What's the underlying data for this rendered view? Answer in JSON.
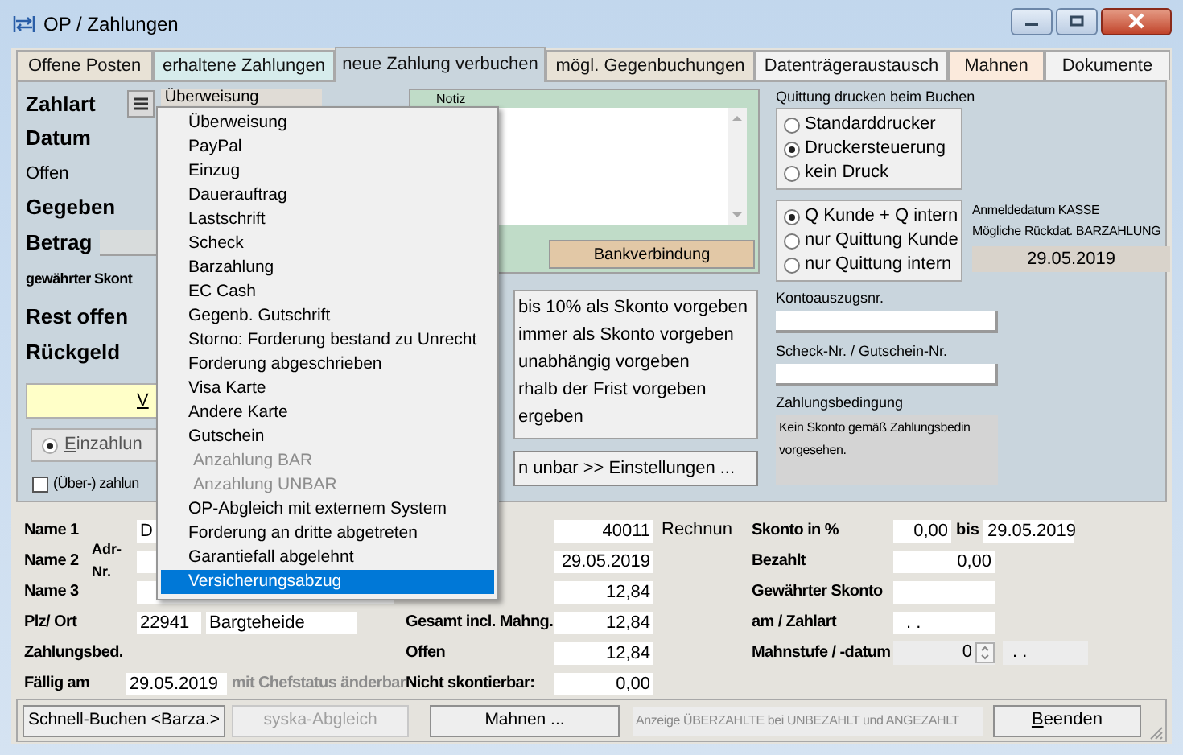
{
  "window": {
    "title": "OP / Zahlungen"
  },
  "tabs": [
    {
      "label": "Offene Posten",
      "selected": false,
      "color": "#e8e2d6"
    },
    {
      "label": "erhaltene Zahlungen",
      "selected": false,
      "color": "#d6ecec"
    },
    {
      "label": "neue Zahlung verbuchen",
      "selected": true,
      "color": "#c9d5dd"
    },
    {
      "label": "mögl. Gegenbuchungen",
      "selected": false,
      "color": "#e8e2d6"
    },
    {
      "label": "Datenträgeraustausch",
      "selected": false,
      "color": "#f2f2f2"
    },
    {
      "label": "Mahnen",
      "selected": false,
      "color": "#fbeadc"
    },
    {
      "label": "Dokumente",
      "selected": false,
      "color": "#f2f2f2"
    }
  ],
  "payment": {
    "zahlart": {
      "label": "Zahlart",
      "value": "Überweisung"
    },
    "labels": [
      {
        "text": "Datum",
        "kind": "heading"
      },
      {
        "text": "Offen",
        "kind": "plain"
      },
      {
        "text": "Gegeben",
        "kind": "heading"
      },
      {
        "text": "Betrag",
        "kind": "field"
      },
      {
        "text": "gewährter Skont",
        "kind": "small"
      },
      {
        "text": "Rest offen",
        "kind": "heading"
      },
      {
        "text": "Rückgeld",
        "kind": "heading"
      }
    ],
    "book_button": {
      "label": "V",
      "underline_first": true
    },
    "mode_radio": {
      "label": "Einzahlun",
      "selected": true,
      "underline_first": true
    },
    "overpay_check": {
      "label": "(Über-) zahlun",
      "checked": false
    }
  },
  "dropdown_menu": {
    "items": [
      {
        "label": "Überweisung",
        "disabled": false,
        "selected": false
      },
      {
        "label": "PayPal",
        "disabled": false,
        "selected": false
      },
      {
        "label": "Einzug",
        "disabled": false,
        "selected": false
      },
      {
        "label": "Dauerauftrag",
        "disabled": false,
        "selected": false
      },
      {
        "label": "Lastschrift",
        "disabled": false,
        "selected": false
      },
      {
        "label": "Scheck",
        "disabled": false,
        "selected": false
      },
      {
        "label": "Barzahlung",
        "disabled": false,
        "selected": false
      },
      {
        "label": "EC Cash",
        "disabled": false,
        "selected": false
      },
      {
        "label": "Gegenb. Gutschrift",
        "disabled": false,
        "selected": false
      },
      {
        "label": "Storno: Forderung bestand zu Unrecht",
        "disabled": false,
        "selected": false
      },
      {
        "label": "Forderung abgeschrieben",
        "disabled": false,
        "selected": false
      },
      {
        "label": "Visa Karte",
        "disabled": false,
        "selected": false
      },
      {
        "label": "Andere Karte",
        "disabled": false,
        "selected": false
      },
      {
        "label": "Gutschein",
        "disabled": false,
        "selected": false
      },
      {
        "label": "Anzahlung BAR",
        "disabled": true,
        "selected": false
      },
      {
        "label": "Anzahlung UNBAR",
        "disabled": true,
        "selected": false
      },
      {
        "label": "OP-Abgleich mit externem System",
        "disabled": false,
        "selected": false
      },
      {
        "label": "Forderung an dritte abgetreten",
        "disabled": false,
        "selected": false
      },
      {
        "label": "Garantiefall abgelehnt",
        "disabled": false,
        "selected": false
      },
      {
        "label": "Versicherungsabzug",
        "disabled": false,
        "selected": true
      }
    ]
  },
  "note": {
    "label": "Notiz",
    "bank_tab": "Bankverbindung"
  },
  "skonto_options": [
    "bis 10% als Skonto vorgeben",
    "immer als Skonto vorgeben",
    "unabhängig vorgeben",
    "rhalb der Frist vorgeben",
    "ergeben"
  ],
  "settings_button": "n unbar >> Einstellungen ...",
  "receipt": {
    "title": "Quittung drucken beim Buchen",
    "printer": [
      {
        "label": "Standarddrucker",
        "selected": false
      },
      {
        "label": "Druckersteuerung",
        "selected": true
      },
      {
        "label": "kein Druck",
        "selected": false
      }
    ],
    "copies": [
      {
        "label": "Q Kunde + Q intern",
        "selected": true
      },
      {
        "label": "nur Quittung Kunde",
        "selected": false
      },
      {
        "label": "nur Quittung intern",
        "selected": false
      }
    ]
  },
  "cash_date": {
    "lines": [
      "Anmeldedatum KASSE",
      "Mögliche Rückdat. BARZAHLUNG"
    ],
    "value": "29.05.2019"
  },
  "kontoauszug": {
    "label": "Kontoauszugsnr."
  },
  "scheck": {
    "label": "Scheck-Nr. / Gutschein-Nr."
  },
  "zahlungsbedingung": {
    "label": "Zahlungsbedingung",
    "lines": [
      "Kein Skonto gemäß Zahlungsbedin",
      "vorgesehen."
    ]
  },
  "details": {
    "address": [
      {
        "label": "Name 1",
        "value": "D"
      },
      {
        "label": "Name 2",
        "sub_label": "Adr-Nr."
      },
      {
        "label": "Name 3"
      },
      {
        "label": "Plz/ Ort",
        "zip": "22941",
        "city": "Bargteheide"
      },
      {
        "label": "Zahlungsbed."
      },
      {
        "label": "Fällig am",
        "value": "29.05.2019",
        "note": "mit Chefstatus änderbar"
      }
    ],
    "amounts": [
      {
        "value": "40011",
        "suffix": "Rechnun"
      },
      {
        "value": "29.05.2019"
      },
      {
        "value": "12,84"
      },
      {
        "label": "Gesamt incl. Mahng.",
        "value": "12,84"
      },
      {
        "label": "Offen",
        "value": "12,84"
      },
      {
        "label": "Nicht skontierbar:",
        "value": "0,00"
      }
    ],
    "skonto": [
      {
        "label": "Skonto in %",
        "kind": "range",
        "value": "0,00",
        "between": "bis",
        "date": "29.05.2019"
      },
      {
        "label": "Bezahlt",
        "kind": "field",
        "value": "0,00"
      },
      {
        "label": "Gewährter Skonto",
        "kind": "field"
      },
      {
        "label": "am / Zahlart",
        "kind": "date_field",
        "value": ". ."
      },
      {
        "label": "Mahnstufe / -datum",
        "kind": "spin",
        "value": "0",
        "date": ". ."
      }
    ]
  },
  "buttons": [
    {
      "label": "Schnell-Buchen <Barza.>",
      "disabled": false
    },
    {
      "label": "syska-Abgleich",
      "disabled": true
    },
    {
      "label": "Mahnen ...",
      "disabled": false
    }
  ],
  "overpaid_info": "Anzeige ÜBERZAHLTE bei UNBEZAHLT und ANGEZAHLT",
  "close_button": {
    "label": "Beenden",
    "underline_first": true
  }
}
